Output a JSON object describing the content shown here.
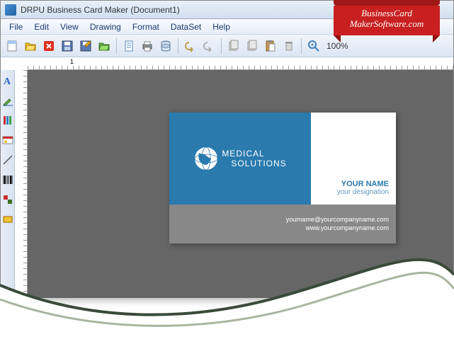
{
  "window": {
    "title": "DRPU Business Card Maker (Document1)"
  },
  "menu": [
    "File",
    "Edit",
    "View",
    "Drawing",
    "Format",
    "DataSet",
    "Help"
  ],
  "toolbar": {
    "zoom": "100%"
  },
  "ribbon": {
    "line1": "BusinessCard",
    "line2": "MakerSoftware.com"
  },
  "card": {
    "title1": "MEDICAL",
    "title2": "SOLUTIONS",
    "name": "YOUR NAME",
    "designation": "your designation",
    "email": "yourname@yourcompanyname.com",
    "website": "www.yourcompanyname.com"
  }
}
